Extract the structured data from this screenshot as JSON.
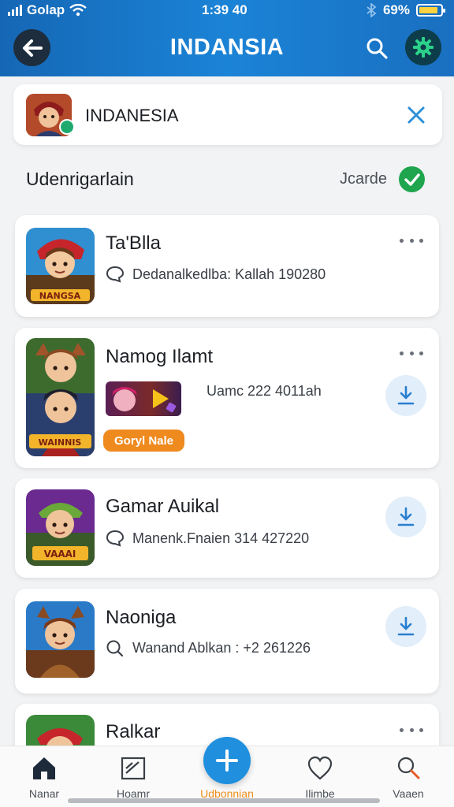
{
  "status_bar": {
    "carrier": "Golap",
    "time": "1:39 40",
    "battery": "69%",
    "battery_level": 0.9
  },
  "header": {
    "title": "INDANSIA",
    "back_icon": "arrow-left-icon",
    "search_icon": "search-icon",
    "settings_icon": "gear-icon"
  },
  "search": {
    "value": "INDANESIA",
    "clear_icon": "close-icon"
  },
  "filter": {
    "label": "Udenrigarlain",
    "sort_label": "Jcarde"
  },
  "items": [
    {
      "title": "Ta'Blla",
      "meta": "Dedanalkedlba: Kallah  190280",
      "meta_icon": "chat-icon",
      "thumb_caption": "NANGSA",
      "action": "more"
    },
    {
      "title": "Namog Ilamt",
      "meta": "Uamc  222 4011ah",
      "meta_icon": "chat-icon",
      "thumb_caption": "WAINNIS",
      "tag": "Goryl Nale",
      "action": "more-download"
    },
    {
      "title": "Gamar Auikal",
      "meta": "Manenk.Fnaien  314  427220",
      "meta_icon": "chat-icon",
      "thumb_caption": "VAAAI",
      "action": "download"
    },
    {
      "title": "Naoniga",
      "meta": "Wanand Ablkan : +2  261226",
      "meta_icon": "search-icon",
      "thumb_caption": "",
      "action": "download"
    },
    {
      "title": "Ralkar",
      "meta": "",
      "thumb_caption": "",
      "action": "more"
    }
  ],
  "bottom_nav": [
    {
      "label": "Nanar",
      "icon": "home-icon",
      "active": false
    },
    {
      "label": "Hoamr",
      "icon": "edit-icon",
      "active": false
    },
    {
      "label": "Udbonnian",
      "icon": "plus-icon",
      "active": true
    },
    {
      "label": "Ilimbe",
      "icon": "heart-icon",
      "active": false
    },
    {
      "label": "Vaaen",
      "icon": "profile-search-icon",
      "active": false
    }
  ],
  "colors": {
    "header_start": "#1567b5",
    "header_end": "#1b83d6",
    "accent": "#1f8fde",
    "success": "#1ea54d",
    "tag": "#ef8a1f"
  }
}
